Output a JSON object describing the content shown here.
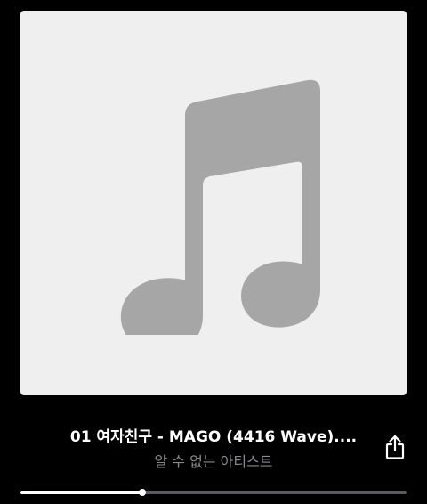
{
  "track": {
    "title": "01 여자친구 - MAGO (4416 Wave)....",
    "artist": "알 수 없는 아티스트"
  },
  "artwork": {
    "icon": "music-note-icon",
    "background_color": "#efefef",
    "icon_color": "#a6a6a6"
  },
  "controls": {
    "share_icon": "share-icon"
  },
  "playback": {
    "progress_fraction": 0.315
  }
}
